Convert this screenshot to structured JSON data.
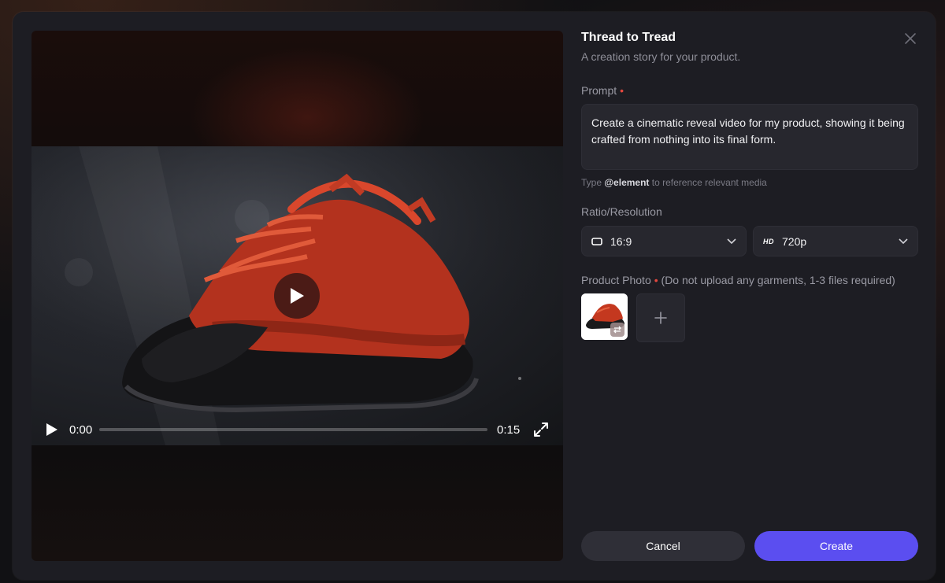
{
  "dialog": {
    "title": "Thread to Tread",
    "subtitle": "A creation story for your product.",
    "close_icon": "close-icon"
  },
  "video": {
    "current_time": "0:00",
    "total_time": "0:15",
    "progress_fraction": 0,
    "play_icon": "play-icon",
    "fullscreen_icon": "fullscreen-icon"
  },
  "prompt": {
    "label": "Prompt",
    "required_mark": "•",
    "value": "Create a cinematic reveal video for my product, showing it being crafted from nothing into its final form.",
    "hint_prefix": "Type",
    "hint_keyword": "@element",
    "hint_suffix": "to reference relevant media"
  },
  "ratio_resolution": {
    "label": "Ratio/Resolution",
    "ratio_value": "16:9",
    "resolution_badge": "HD",
    "resolution_value": "720p"
  },
  "product_photo": {
    "label": "Product Photo",
    "required_mark": "•",
    "note": "(Do not upload any garments, 1-3 files required)",
    "add_symbol": "+"
  },
  "actions": {
    "cancel_label": "Cancel",
    "create_label": "Create"
  },
  "colors": {
    "accent": "#5b4ef0",
    "required": "#e5483f",
    "panel_bg": "#1d1d23"
  }
}
